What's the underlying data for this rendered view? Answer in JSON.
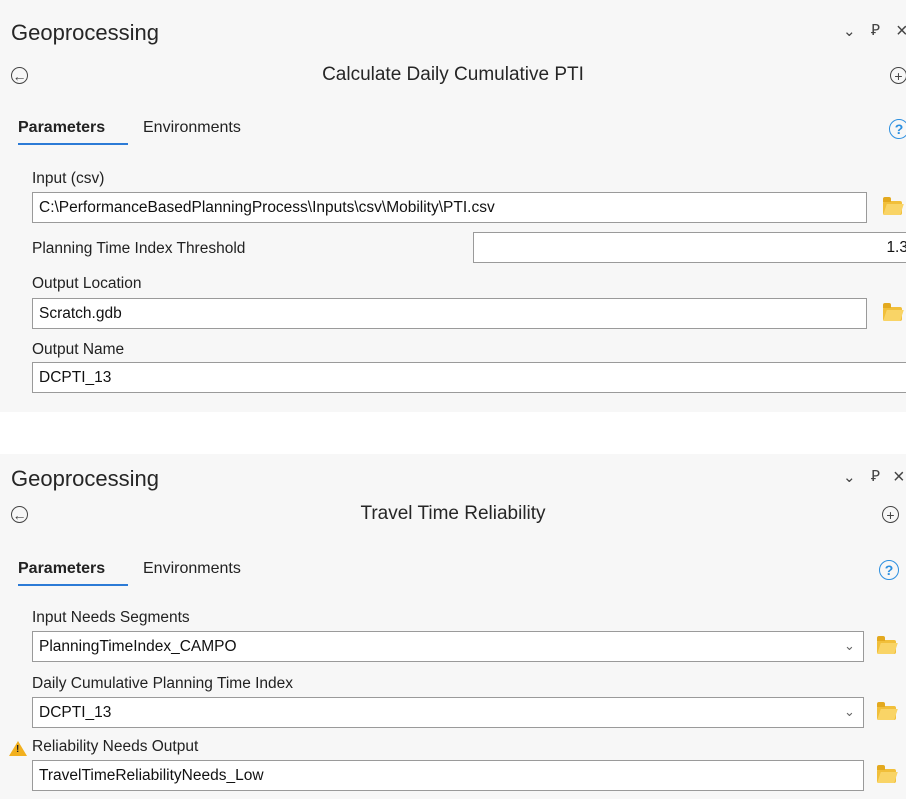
{
  "panel1": {
    "title": "Geoprocessing",
    "tool_title": "Calculate Daily Cumulative PTI",
    "tabs": [
      "Parameters",
      "Environments"
    ],
    "help_label": "?",
    "params": [
      {
        "label": "Input (csv)",
        "value": "C:\\PerformanceBasedPlanningProcess\\Inputs\\csv\\Mobility\\PTI.csv"
      },
      {
        "label": "Planning Time Index Threshold",
        "value": "1.3"
      },
      {
        "label": "Output Location",
        "value": "Scratch.gdb"
      },
      {
        "label": "Output Name",
        "value": "DCPTI_13"
      }
    ]
  },
  "panel2": {
    "title": "Geoprocessing",
    "tool_title": "Travel Time Reliability",
    "tabs": [
      "Parameters",
      "Environments"
    ],
    "help_label": "?",
    "params": [
      {
        "label": "Input Needs Segments",
        "value": "PlanningTimeIndex_CAMPO"
      },
      {
        "label": "Daily Cumulative Planning Time Index",
        "value": "DCPTI_13"
      },
      {
        "label": "Reliability Needs Output",
        "value": "TravelTimeReliabilityNeeds_Low"
      }
    ]
  },
  "window_controls": {
    "menu": "⌄",
    "pin": "Ꝑ",
    "close": "×"
  },
  "icons": {
    "back": "back-arrow-icon",
    "add": "add-icon",
    "folder": "folder-icon",
    "warning": "warning-icon",
    "dropdown": "chevron-down-icon"
  },
  "colors": {
    "accent": "#2c7bd6",
    "folder": "#f1bf3a",
    "warning": "#f2b01e"
  }
}
